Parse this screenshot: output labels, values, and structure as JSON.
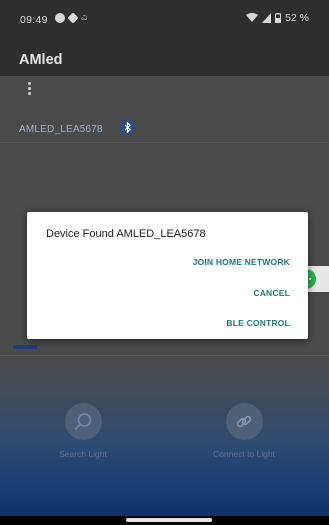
{
  "status_bar": {
    "time": "09:49",
    "battery": "52 %"
  },
  "app_bar": {
    "title": "AMled"
  },
  "device_list": {
    "items": [
      {
        "name": "AMLED_LEA5678"
      }
    ]
  },
  "dialog": {
    "title": "Device Found AMLED_LEA5678",
    "buttons": {
      "join": "JOIN HOME NETWORK",
      "cancel": "CANCEL",
      "ble": "BLE CONTROL"
    }
  },
  "actions": {
    "search": {
      "label": "Search Light",
      "icon": "magnifier-icon"
    },
    "connect": {
      "label": "Connect to Light",
      "icon": "link-icon"
    }
  },
  "colors": {
    "dialog_accent": "#1b7a72",
    "chat_badge": "#2bb24c",
    "bluetooth": "#2a4f86"
  }
}
